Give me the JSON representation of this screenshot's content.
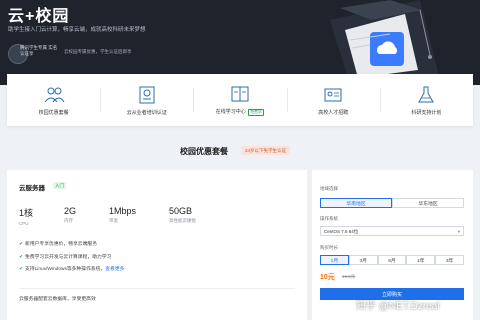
{
  "hero": {
    "title": "云+校园",
    "subtitle": "助学生接入门云计算，畅享云端，成就高校科研未来梦想",
    "badge_text": "腾讯学生专属\n实名认证享",
    "note": "云校园专属优惠，学生认证后即享"
  },
  "features": [
    {
      "label": "校园优惠套餐",
      "icon": "people-icon"
    },
    {
      "label": "云从业者培训认证",
      "icon": "certificate-icon"
    },
    {
      "label": "在线学习中心",
      "icon": "book-icon",
      "tag": "免费学"
    },
    {
      "label": "高校人才招聘",
      "icon": "id-card-icon"
    },
    {
      "label": "科研支持计划",
      "icon": "flask-icon"
    }
  ],
  "section": {
    "title": "校园优惠套餐",
    "pill": "24岁以下免学生认证"
  },
  "product": {
    "name": "云服务器",
    "tag": "入门",
    "specs": [
      {
        "value": "1核",
        "label": "CPU"
      },
      {
        "value": "2G",
        "label": "内存"
      },
      {
        "value": "1Mbps",
        "label": "带宽"
      },
      {
        "value": "50GB",
        "label": "高性能云硬盘"
      }
    ],
    "perks": [
      {
        "text": "新用户专享优惠价，畅享云端服务",
        "link": ""
      },
      {
        "text": "免费学习云开发与云计算课程，助力学习",
        "link": ""
      },
      {
        "text": "支持Linux/Windows等多种操作系统，",
        "link": "查看更多"
      }
    ],
    "footnote": "云服务器配套云数据库，享受更高效"
  },
  "order": {
    "region_label": "地域选择",
    "regions": [
      {
        "label": "华南地区",
        "active": true
      },
      {
        "label": "华东地区",
        "active": false
      }
    ],
    "image_label": "操作系统",
    "image_value": "CentOS 7.6 64位",
    "duration_label": "购买时长",
    "durations": [
      {
        "label": "1月",
        "active": true
      },
      {
        "label": "3月",
        "active": false
      },
      {
        "label": "6月",
        "active": false
      },
      {
        "label": "1年",
        "active": false
      },
      {
        "label": "3年",
        "active": false
      }
    ],
    "price": "10元",
    "price_orig": "15.5元",
    "buy_label": "立即购买"
  },
  "watermark": "知乎 @NET.Dzreal",
  "colors": {
    "accent": "#1f6feb",
    "success": "#1fa34a",
    "price": "#ff6a00",
    "hero_bg": "#1e232c"
  }
}
